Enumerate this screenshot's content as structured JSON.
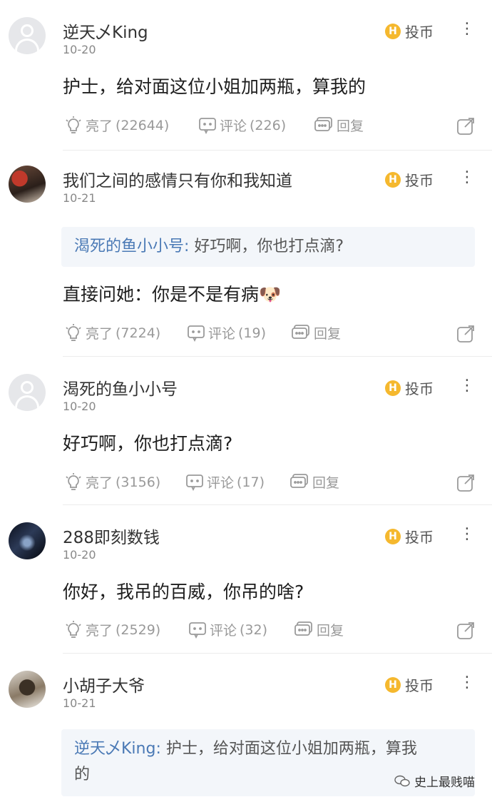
{
  "coin_label": "投币",
  "coin_glyph": "H",
  "more_glyph": "⋮",
  "actions": {
    "like": "亮了",
    "comment": "评论",
    "reply": "回复"
  },
  "comments": [
    {
      "user": "逆天乄King",
      "date": "10-20",
      "content": "护士，给对面这位小姐加两瓶，算我的",
      "likes": "(22644)",
      "comments": "(226)"
    },
    {
      "user": "我们之间的感情只有你和我知道",
      "date": "10-21",
      "quote_user": "渴死的鱼小小号:",
      "quote_text": "好巧啊，你也打点滴?",
      "content": "直接问她：你是不是有病",
      "emoji": "🐶",
      "likes": "(7224)",
      "comments": "(19)"
    },
    {
      "user": "渴死的鱼小小号",
      "date": "10-20",
      "content": "好巧啊，你也打点滴?",
      "likes": "(3156)",
      "comments": "(17)"
    },
    {
      "user": "288即刻数钱",
      "date": "10-20",
      "content": "你好，我吊的百威，你吊的啥?",
      "likes": "(2529)",
      "comments": "(32)"
    },
    {
      "user": "小胡子大爷",
      "date": "10-21",
      "quote_user": "逆天乄King:",
      "quote_text_line1": "护士，给对面这位小姐加两瓶，算我",
      "quote_text_line2": "的"
    }
  ],
  "watermark": "史上最贱喵",
  "colors": {
    "accent_blue": "#4a79b5",
    "coin_gold": "#f5b82e",
    "muted": "#999999"
  }
}
